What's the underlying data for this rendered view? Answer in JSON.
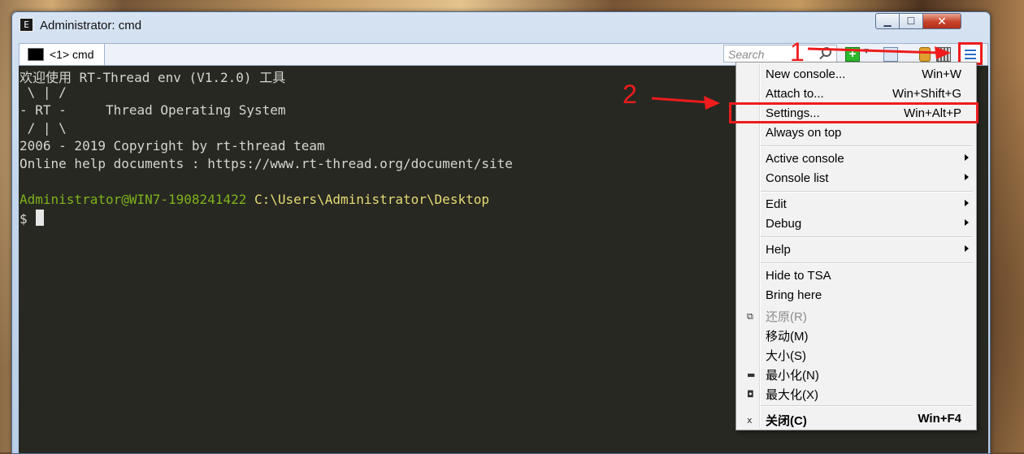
{
  "window": {
    "title": "Administrator: cmd",
    "app_icon_glyph": "E",
    "controls": {
      "minimize": "▁",
      "maximize": "☐",
      "close": "✕"
    }
  },
  "tabbar": {
    "tab_label": "<1> cmd",
    "search_placeholder": "Search",
    "new_console": "+",
    "new_console_dropdown": "▼"
  },
  "console": {
    "lines": [
      "欢迎使用 RT-Thread env (V1.2.0) 工具",
      " \\ | /",
      "- RT -     Thread Operating System",
      " / | \\",
      "2006 - 2019 Copyright by rt-thread team",
      "Online help documents : https://www.rt-thread.org/document/site"
    ],
    "prompt_user": "Administrator@WIN7-1908241422",
    "prompt_path": " C:\\Users\\Administrator\\Desktop",
    "prompt_symbol": "$"
  },
  "menu": {
    "items": [
      {
        "label": "New console...",
        "shortcut": "Win+W"
      },
      {
        "label": "Attach to...",
        "shortcut": "Win+Shift+G"
      },
      {
        "label": "Settings...",
        "shortcut": "Win+Alt+P"
      },
      {
        "label": "Always on top",
        "shortcut": ""
      },
      {
        "label": "Active console",
        "shortcut": ""
      },
      {
        "label": "Console list",
        "shortcut": ""
      },
      {
        "label": "Edit",
        "shortcut": ""
      },
      {
        "label": "Debug",
        "shortcut": ""
      },
      {
        "label": "Help",
        "shortcut": ""
      },
      {
        "label": "Hide to TSA",
        "shortcut": ""
      },
      {
        "label": "Bring here",
        "shortcut": ""
      },
      {
        "label": "还原(R)",
        "shortcut": "",
        "icon": "⧉"
      },
      {
        "label": "移动(M)",
        "shortcut": ""
      },
      {
        "label": "大小(S)",
        "shortcut": ""
      },
      {
        "label": "最小化(N)",
        "shortcut": "",
        "icon": "▬"
      },
      {
        "label": "最大化(X)",
        "shortcut": "",
        "icon": "◘"
      },
      {
        "label": "关闭(C)",
        "shortcut": "Win+F4",
        "icon": "x"
      }
    ]
  },
  "annotations": {
    "step1": "1",
    "step2": "2",
    "color": "#ee1c1c"
  }
}
